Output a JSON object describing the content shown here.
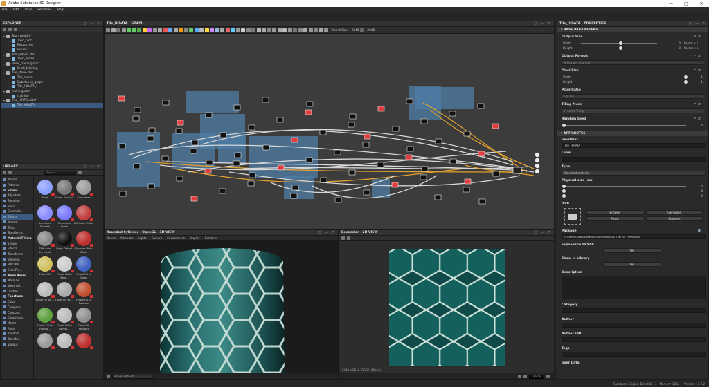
{
  "app": {
    "title": "Adobe Substance 3D Designer"
  },
  "menu": [
    "File",
    "Edit",
    "Tools",
    "Windows",
    "Help"
  ],
  "explorer": {
    "title": "EXPLORER",
    "items": [
      {
        "label": "Toon_rooftile*",
        "level": 0,
        "expanded": true
      },
      {
        "label": "Toon_roof",
        "level": 1
      },
      {
        "label": "Resources",
        "level": 1
      },
      {
        "label": "leaves2",
        "level": 1
      },
      {
        "label": "Toon_Wood.sbs",
        "level": 0,
        "expanded": true
      },
      {
        "label": "Toon_Wood",
        "level": 1
      },
      {
        "label": "Brick_training.sbs*",
        "level": 0,
        "expanded": true
      },
      {
        "label": "Brick_training",
        "level": 1
      },
      {
        "label": "Tile_stone.sbs",
        "level": 0,
        "expanded": true
      },
      {
        "label": "Tile_stone",
        "level": 1
      },
      {
        "label": "Substance_graph",
        "level": 1
      },
      {
        "label": "Tile_HIRATA_1",
        "level": 1
      },
      {
        "label": "training.sbs*",
        "level": 0,
        "expanded": true
      },
      {
        "label": "training",
        "level": 1
      },
      {
        "label": "Tile_HIRATA.sbs*",
        "level": 0,
        "expanded": true
      },
      {
        "label": "Tile_HIRATA",
        "level": 1,
        "selected": true
      }
    ]
  },
  "library": {
    "title": "LIBRARY",
    "search_placeholder": "Search",
    "categories": [
      {
        "label": "Noises"
      },
      {
        "label": "Patterns"
      },
      {
        "label": "Filters",
        "head": true
      },
      {
        "label": "Adjustme..."
      },
      {
        "label": "Blending"
      },
      {
        "label": "Blurs"
      },
      {
        "label": "Channels..."
      },
      {
        "label": "Effects",
        "selected": true
      },
      {
        "label": "Normal ..."
      },
      {
        "label": "Tiling"
      },
      {
        "label": "Transforms"
      },
      {
        "label": "Material Filters",
        "head": true
      },
      {
        "label": "1-Click"
      },
      {
        "label": "Effects"
      },
      {
        "label": "Transforms"
      },
      {
        "label": "Blending"
      },
      {
        "label": "PBR Utili..."
      },
      {
        "label": "Scan Pro..."
      },
      {
        "label": "Mesh Based ...",
        "head": true
      },
      {
        "label": "Mask Ge..."
      },
      {
        "label": "Weatheri..."
      },
      {
        "label": "Utilities"
      },
      {
        "label": "Functions",
        "head": true
      },
      {
        "label": "Color"
      },
      {
        "label": "Comparis..."
      },
      {
        "label": "Constant"
      },
      {
        "label": "Conversion"
      },
      {
        "label": "Maths"
      },
      {
        "label": "Parity"
      },
      {
        "label": "Random"
      },
      {
        "label": "Transfor..."
      },
      {
        "label": "Various"
      }
    ],
    "items": [
      {
        "label": "Bevel",
        "color": "#8aa0ff"
      },
      {
        "label": "Cross Section",
        "color": "#777777"
      },
      {
        "label": "Curvature",
        "color": "#9a9a9a"
      },
      {
        "label": "Curvature Smooth",
        "color": "#8a8cff"
      },
      {
        "label": "Curvature Sobel",
        "color": "#7a7aff"
      },
      {
        "label": "Diffusion Color",
        "color": "#c04040"
      },
      {
        "label": "Diffusion Greyscale",
        "color": "#888888"
      },
      {
        "label": "Edge Detect",
        "color": "#111111"
      },
      {
        "label": "Emboss With Gloss",
        "color": "#c03030"
      },
      {
        "label": "Flood Fill",
        "color": "#d0c060"
      },
      {
        "label": "Flood Fill to Bbo...",
        "color": "#cccccc"
      },
      {
        "label": "Flood Fill to Color",
        "color": "#4060c0"
      },
      {
        "label": "Flood Fill to ...",
        "color": "#bbbbbb"
      },
      {
        "label": "Flood Fill to ...",
        "color": "#aaaaaa"
      },
      {
        "label": "Flood Fill to Position",
        "color": "#c05030"
      },
      {
        "label": "Flood Fill to Rando...",
        "color": "#60a040"
      },
      {
        "label": "Flood Fill to Rando...",
        "color": "#bbbbbb"
      },
      {
        "label": "Flood Fill Mapper",
        "color": "#909090"
      },
      {
        "label": "",
        "color": "#999999"
      },
      {
        "label": "",
        "color": "#bbbbbb"
      },
      {
        "label": "",
        "color": "#c03030"
      }
    ]
  },
  "graph": {
    "title": "Tile_HIRATA - GRAPH",
    "parent_size_label": "Parent Size:",
    "parent_size_a": "2048",
    "parent_size_b": "2048"
  },
  "view3d": {
    "title": "Rounded Cylinder - OpenGL - 3D VIEW",
    "menus": [
      "Scene",
      "Materials",
      "Lights",
      "Camera",
      "Environment",
      "Display",
      "Renderer"
    ],
    "colorspace": "sRGB (default)"
  },
  "view2d": {
    "title": "Basecolor - 2D VIEW",
    "info": "2048 x 2048 (RGBA, 16bpc)",
    "zoom": "23.8 %"
  },
  "properties": {
    "title": "Tile_HIRATA - PROPERTIES",
    "base_section": "BASE PARAMETERS",
    "output_size": {
      "label": "Output Size",
      "width_label": "Width",
      "width_value": "0",
      "width_rel": "Parent x 1",
      "height_label": "Height",
      "height_value": "0",
      "height_rel": "Parent x 1",
      "width_fraction": 0.5,
      "height_fraction": 0.5
    },
    "output_format": {
      "label": "Output Format",
      "value": "8 Bits per Channel"
    },
    "pixel_size": {
      "label": "Pixel Size",
      "width_label": "Width",
      "width_value": "1",
      "height_label": "Height",
      "height_value": "1"
    },
    "pixel_ratio": {
      "label": "Pixel Ratio",
      "value": "Square"
    },
    "tiling_mode": {
      "label": "Tiling Mode",
      "value": "H and V Tiling"
    },
    "random_seed": {
      "label": "Random Seed",
      "value": "0"
    },
    "attributes_section": "ATTRIBUTES",
    "identifier": {
      "label": "Identifier",
      "value": "Tile_HIRATA"
    },
    "label_field": {
      "label": "Label",
      "value": ""
    },
    "type": {
      "label": "Type",
      "value": "Standard material"
    },
    "physical_size": {
      "label": "Physical size (cm)",
      "x": "0",
      "y": "0",
      "z": "0"
    },
    "icon": {
      "label": "Icon",
      "browse": "Browse",
      "generate": "Generate",
      "paste": "Paste",
      "remove": "Remove"
    },
    "package": {
      "label": "Package",
      "value": "C:/Users/uuebu/Desktop/Training/HIRATA_Tile/Tile_HIRATA.sbs"
    },
    "exposed": {
      "label": "Exposed in SBSAR",
      "value": "Yes"
    },
    "show_library": {
      "label": "Show In Library",
      "value": "Yes"
    },
    "description": {
      "label": "Description"
    },
    "category": {
      "label": "Category"
    },
    "author": {
      "label": "Author"
    },
    "author_url": {
      "label": "Author URL"
    },
    "tags": {
      "label": "Tags"
    },
    "user_data": {
      "label": "User Data"
    }
  },
  "status": {
    "text": "Substance Engine: Direct3D 11 · Memory: 13%",
    "version": "Version: 11.2.2"
  }
}
